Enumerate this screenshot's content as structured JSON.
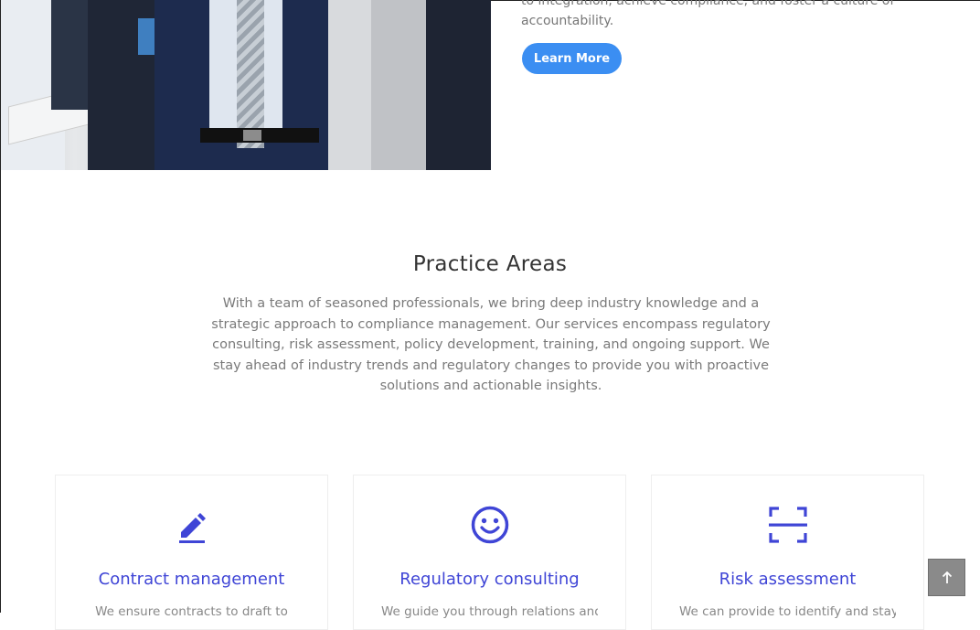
{
  "hero": {
    "text_line1": "to integration, achieve compliance, and foster a culture of",
    "text_line2": "accountability.",
    "button_label": "Learn More"
  },
  "practice": {
    "title": "Practice Areas",
    "description": "With a team of seasoned professionals, we bring deep industry knowledge and a strategic approach to compliance management. Our services encompass regulatory consulting, risk assessment, policy development, training, and ongoing support. We stay ahead of industry trends and regulatory changes to provide you with proactive solutions and actionable insights.",
    "cards": [
      {
        "icon": "pencil-icon",
        "title": "Contract management",
        "text": "We ensure contracts to draft to"
      },
      {
        "icon": "smiley-icon",
        "title": "Regulatory consulting",
        "text": "We guide you through relations and"
      },
      {
        "icon": "scan-frame-icon",
        "title": "Risk assessment",
        "text": "We can provide to identify and stay"
      }
    ]
  },
  "back_to_top": {
    "icon": "arrow-up-icon"
  },
  "colors": {
    "accent": "#3b8ef2",
    "icon_blue": "#3f45d6",
    "text": "#777777"
  }
}
